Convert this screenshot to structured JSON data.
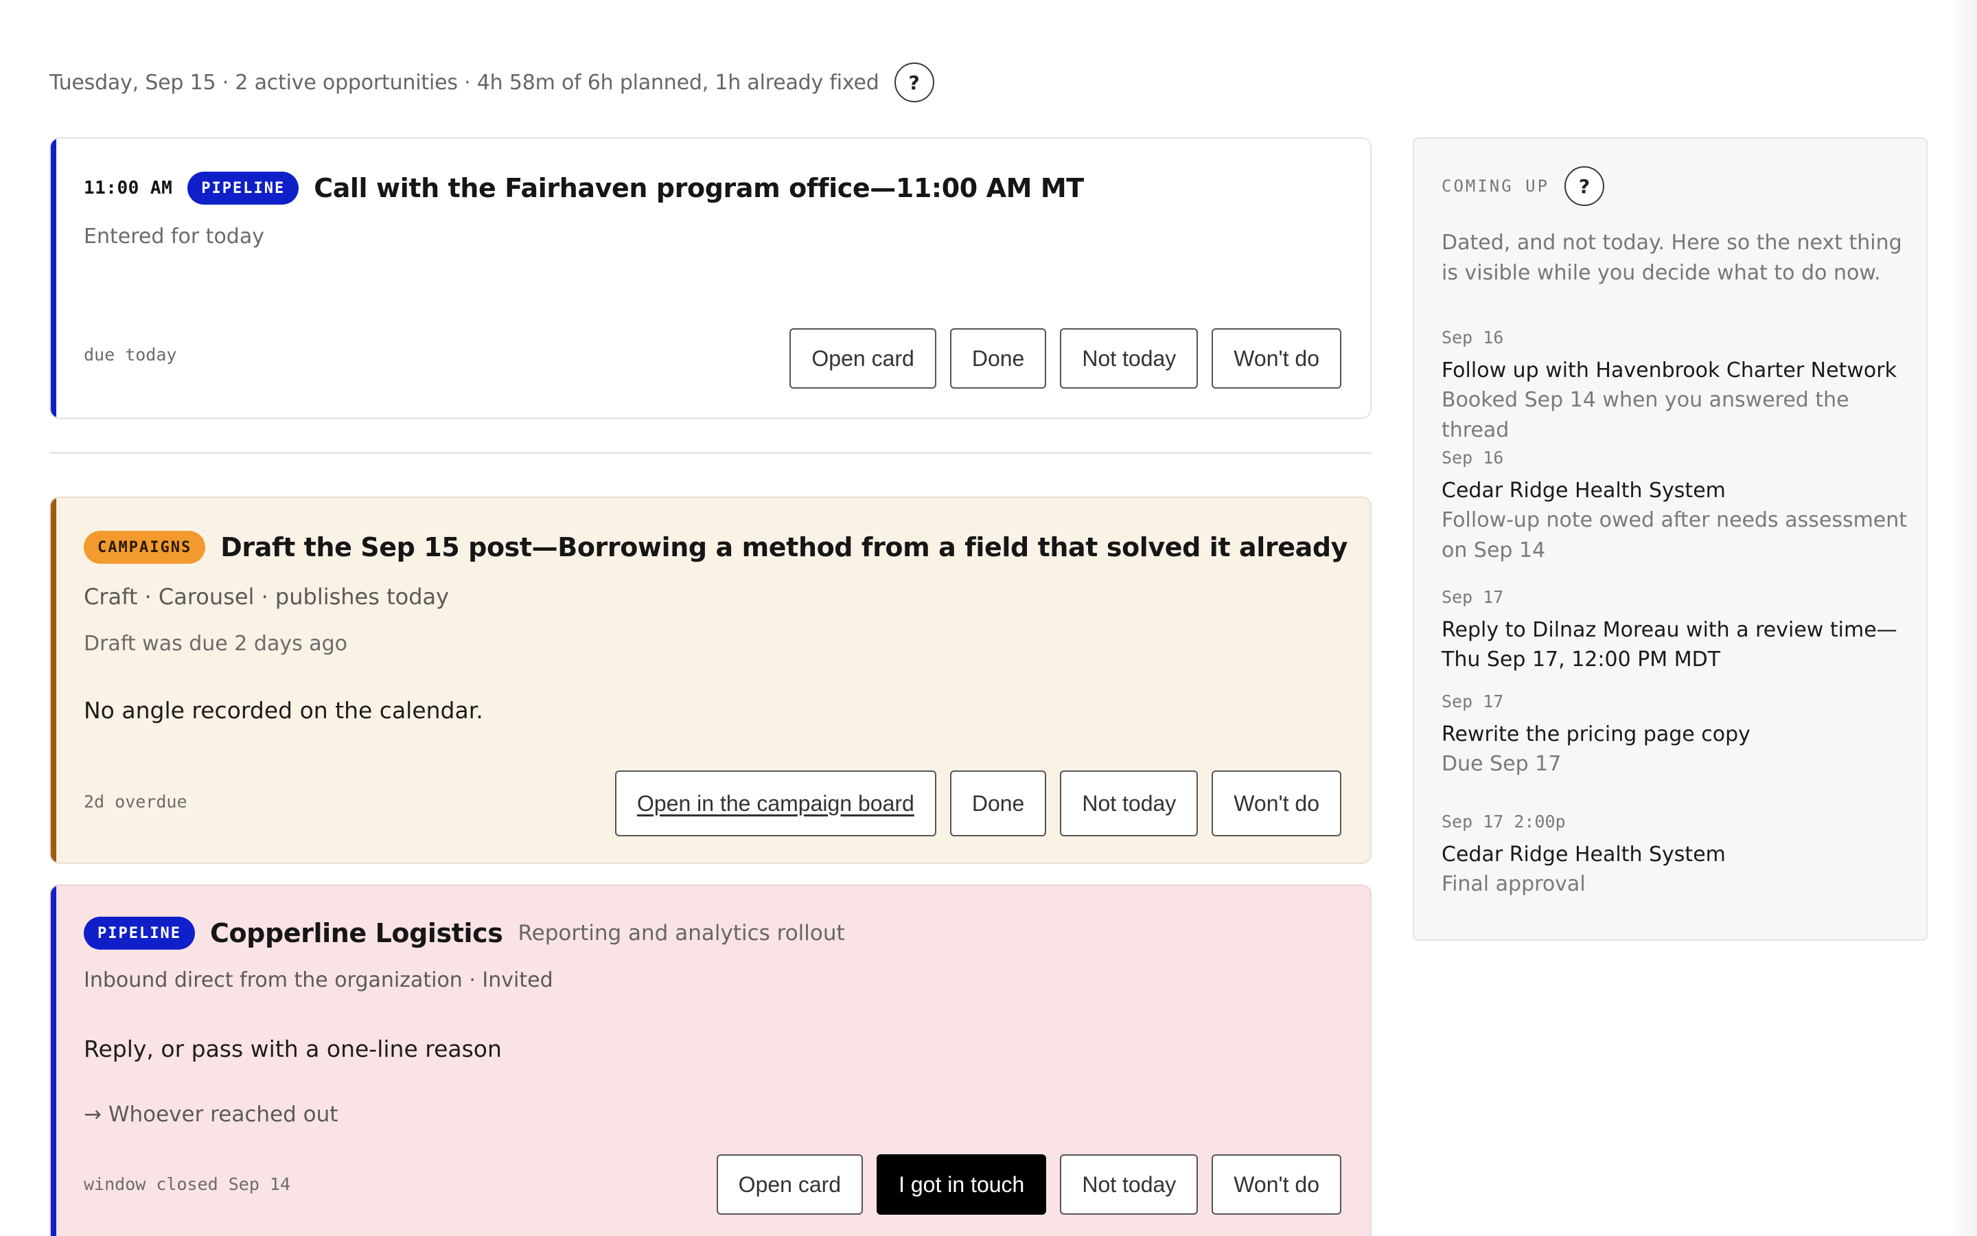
{
  "header": {
    "summary": "Tuesday, Sep 15 · 2 active opportunities · 4h 58m of 6h planned, 1h already fixed",
    "help_label": "?"
  },
  "cards": [
    {
      "time": "11:00 AM",
      "badge": "PIPELINE",
      "title": "Call with the Fairhaven program office—11:00 AM MT",
      "lines": [
        "Entered for today"
      ],
      "footer": "due today",
      "actions": [
        "Open card",
        "Done",
        "Not today",
        "Won't do"
      ]
    },
    {
      "badge": "CAMPAIGNS",
      "title": "Draft the Sep 15 post—Borrowing a method from a field that solved it already",
      "lines": [
        "Craft · Carousel · publishes today",
        "Draft was due 2 days ago",
        "No angle recorded on the calendar."
      ],
      "footer": "2d overdue",
      "actions": [
        "Open in the campaign board",
        "Done",
        "Not today",
        "Won't do"
      ]
    },
    {
      "badge": "PIPELINE",
      "title": "Copperline Logistics",
      "subtitle": "Reporting and analytics rollout",
      "lines": [
        "Inbound direct from the organization · Invited",
        "Reply, or pass with a one-line reason",
        "→ Whoever reached out"
      ],
      "footer": "window closed Sep 14",
      "actions": [
        "Open card",
        "I got in touch",
        "Not today",
        "Won't do"
      ]
    }
  ],
  "coming_up": {
    "label": "COMING UP",
    "help_label": "?",
    "intro": "Dated, and not today. Here so the next thing is visible while you decide what to do now.",
    "items": [
      {
        "date": "Sep 16",
        "title": "Follow up with Havenbrook Charter Network",
        "note": "Booked Sep 14 when you answered the thread"
      },
      {
        "date": "Sep 16",
        "title": "Cedar Ridge Health System",
        "note": "Follow-up note owed after needs assessment on Sep 14"
      },
      {
        "date": "Sep 17",
        "title": "Reply to Dilnaz Moreau with a review time—Thu Sep 17, 12:00 PM MDT",
        "note": ""
      },
      {
        "date": "Sep 17",
        "title": "Rewrite the pricing page copy",
        "note": "Due Sep 17"
      },
      {
        "date": "Sep 17 2:00p",
        "title": "Cedar Ridge Health System",
        "note": "Final approval"
      }
    ]
  }
}
